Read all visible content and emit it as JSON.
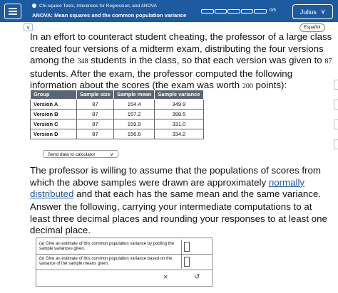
{
  "header": {
    "breadcrumb": "Chi-square Tests, Inferences for Regression, and ANOVA",
    "title": "ANOVA: Mean squares and the common population variance",
    "progress_text": "0/5",
    "user_name": "Julius"
  },
  "espanol_label": "Español",
  "problem": {
    "text_1": "In an effort to counteract student cheating, the professor of a large class created four versions of a midterm exam, distributing the four versions among the ",
    "n_students": "348",
    "text_2": " students in the class, so that each version was given to ",
    "per_version": "87",
    "text_3": " students. After the exam, the professor computed the following information about the scores (the exam was worth ",
    "max_points": "200",
    "text_4": " points):"
  },
  "table": {
    "headers": [
      "Group",
      "Sample size",
      "Sample mean",
      "Sample variance"
    ],
    "rows": [
      [
        "Version A",
        "87",
        "154.4",
        "349.9"
      ],
      [
        "Version B",
        "87",
        "157.2",
        "398.5"
      ],
      [
        "Version C",
        "87",
        "159.9",
        "331.0"
      ],
      [
        "Version D",
        "87",
        "156.6",
        "334.2"
      ]
    ]
  },
  "send_button": "Send data to calculator",
  "assumption": {
    "text_1": "The professor is willing to assume that the populations of scores from which the above samples were drawn are approximately ",
    "link": "normally distributed",
    "text_2": " and that each has the same mean and the same variance."
  },
  "instructions": "Answer the following, carrying your intermediate computations to at least three decimal places and rounding your responses to at least one decimal place.",
  "questions": {
    "a": "(a) Give an estimate of this common population variance by pooling the sample variances given.",
    "b": "(b) Give an estimate of this common population variance based on the variance of the sample means given."
  },
  "actions": {
    "clear": "×",
    "undo": "↺"
  }
}
